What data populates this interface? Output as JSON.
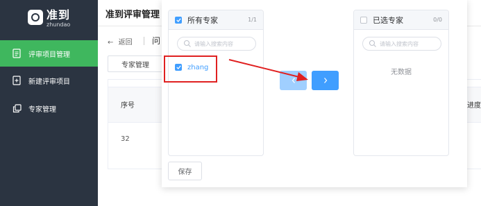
{
  "app": {
    "logo_cn": "准到",
    "logo_en": "zhundao"
  },
  "sidebar": {
    "items": [
      {
        "label": "评审项目管理",
        "icon": "document-icon",
        "active": true
      },
      {
        "label": "新建评审项目",
        "icon": "new-document-icon",
        "active": false
      },
      {
        "label": "专家管理",
        "icon": "copy-icon",
        "active": false
      }
    ]
  },
  "header": {
    "title": "准到评审管理"
  },
  "content": {
    "back_label": "返回",
    "crumb_tail": "问",
    "tab_label": "专家管理",
    "table": {
      "headers": [
        "序号",
        "审进度"
      ],
      "rows": [
        [
          "32"
        ]
      ]
    }
  },
  "transfer": {
    "left": {
      "title": "所有专家",
      "count": "1/1",
      "search_placeholder": "请输入搜索内容",
      "items": [
        {
          "label": "zhang",
          "checked": true
        }
      ]
    },
    "right": {
      "title": "已选专家",
      "count": "0/0",
      "search_placeholder": "请输入搜索内容",
      "empty_text": "无数据"
    },
    "move_left_icon": "chevron-left-icon",
    "move_right_icon": "chevron-right-icon",
    "save_label": "保存"
  },
  "colors": {
    "sidebar_bg": "#2b3441",
    "active_green": "#3fb75e",
    "primary_blue": "#409eff",
    "disabled_blue": "#a0cfff",
    "annotation_red": "#e02020"
  }
}
